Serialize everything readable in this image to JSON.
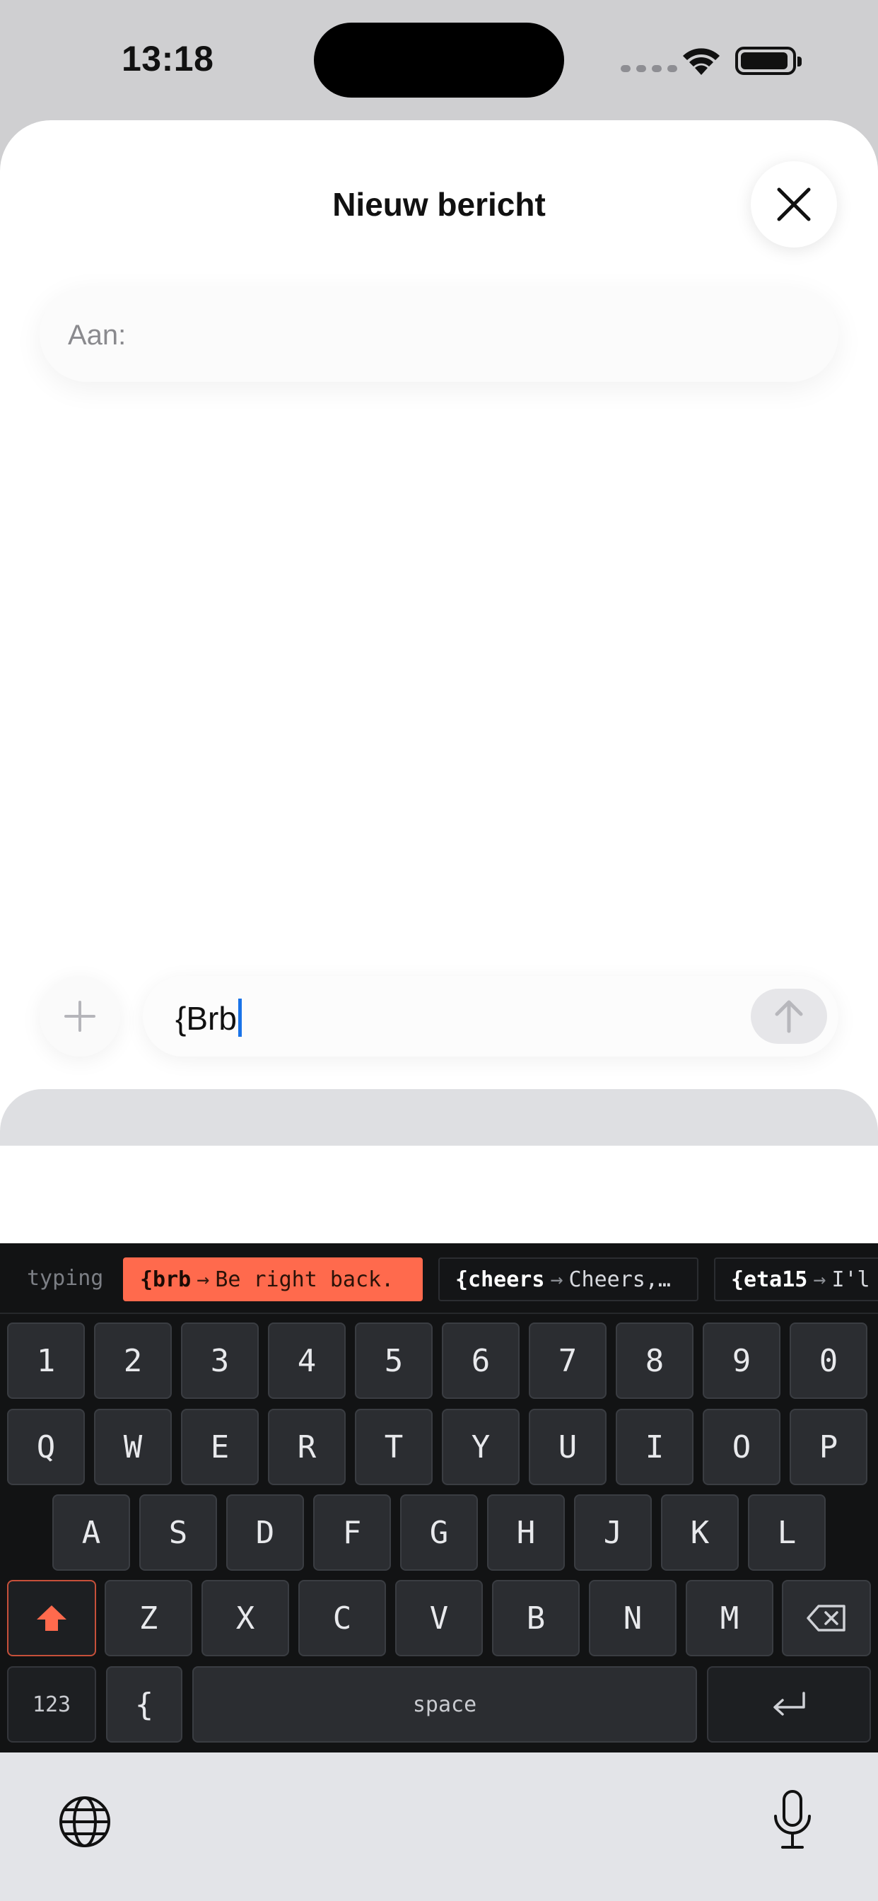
{
  "status": {
    "time": "13:18"
  },
  "sheet": {
    "title": "Nieuw bericht",
    "to_label": "Aan:"
  },
  "compose": {
    "text": "{Brb"
  },
  "suggestions": {
    "label": "typing",
    "chips": [
      {
        "trigger": "{brb",
        "expansion": "Be right back.",
        "active": true
      },
      {
        "trigger": "{cheers",
        "expansion": "Cheers,…",
        "active": false
      },
      {
        "trigger": "{eta15",
        "expansion": "I'l",
        "active": false
      }
    ]
  },
  "keyboard": {
    "row_numbers": [
      "1",
      "2",
      "3",
      "4",
      "5",
      "6",
      "7",
      "8",
      "9",
      "0"
    ],
    "row_top": [
      "Q",
      "W",
      "E",
      "R",
      "T",
      "Y",
      "U",
      "I",
      "O",
      "P"
    ],
    "row_mid": [
      "A",
      "S",
      "D",
      "F",
      "G",
      "H",
      "J",
      "K",
      "L"
    ],
    "row_bottom": [
      "Z",
      "X",
      "C",
      "V",
      "B",
      "N",
      "M"
    ],
    "numbers_key": "123",
    "brace_key": "{",
    "space_key": "space",
    "accent_color": "#ff6a4d"
  },
  "icons": [
    "close-icon",
    "plus-icon",
    "send-arrow-icon",
    "shift-icon",
    "backspace-icon",
    "return-icon",
    "globe-icon",
    "microphone-icon",
    "wifi-icon",
    "battery-icon"
  ]
}
